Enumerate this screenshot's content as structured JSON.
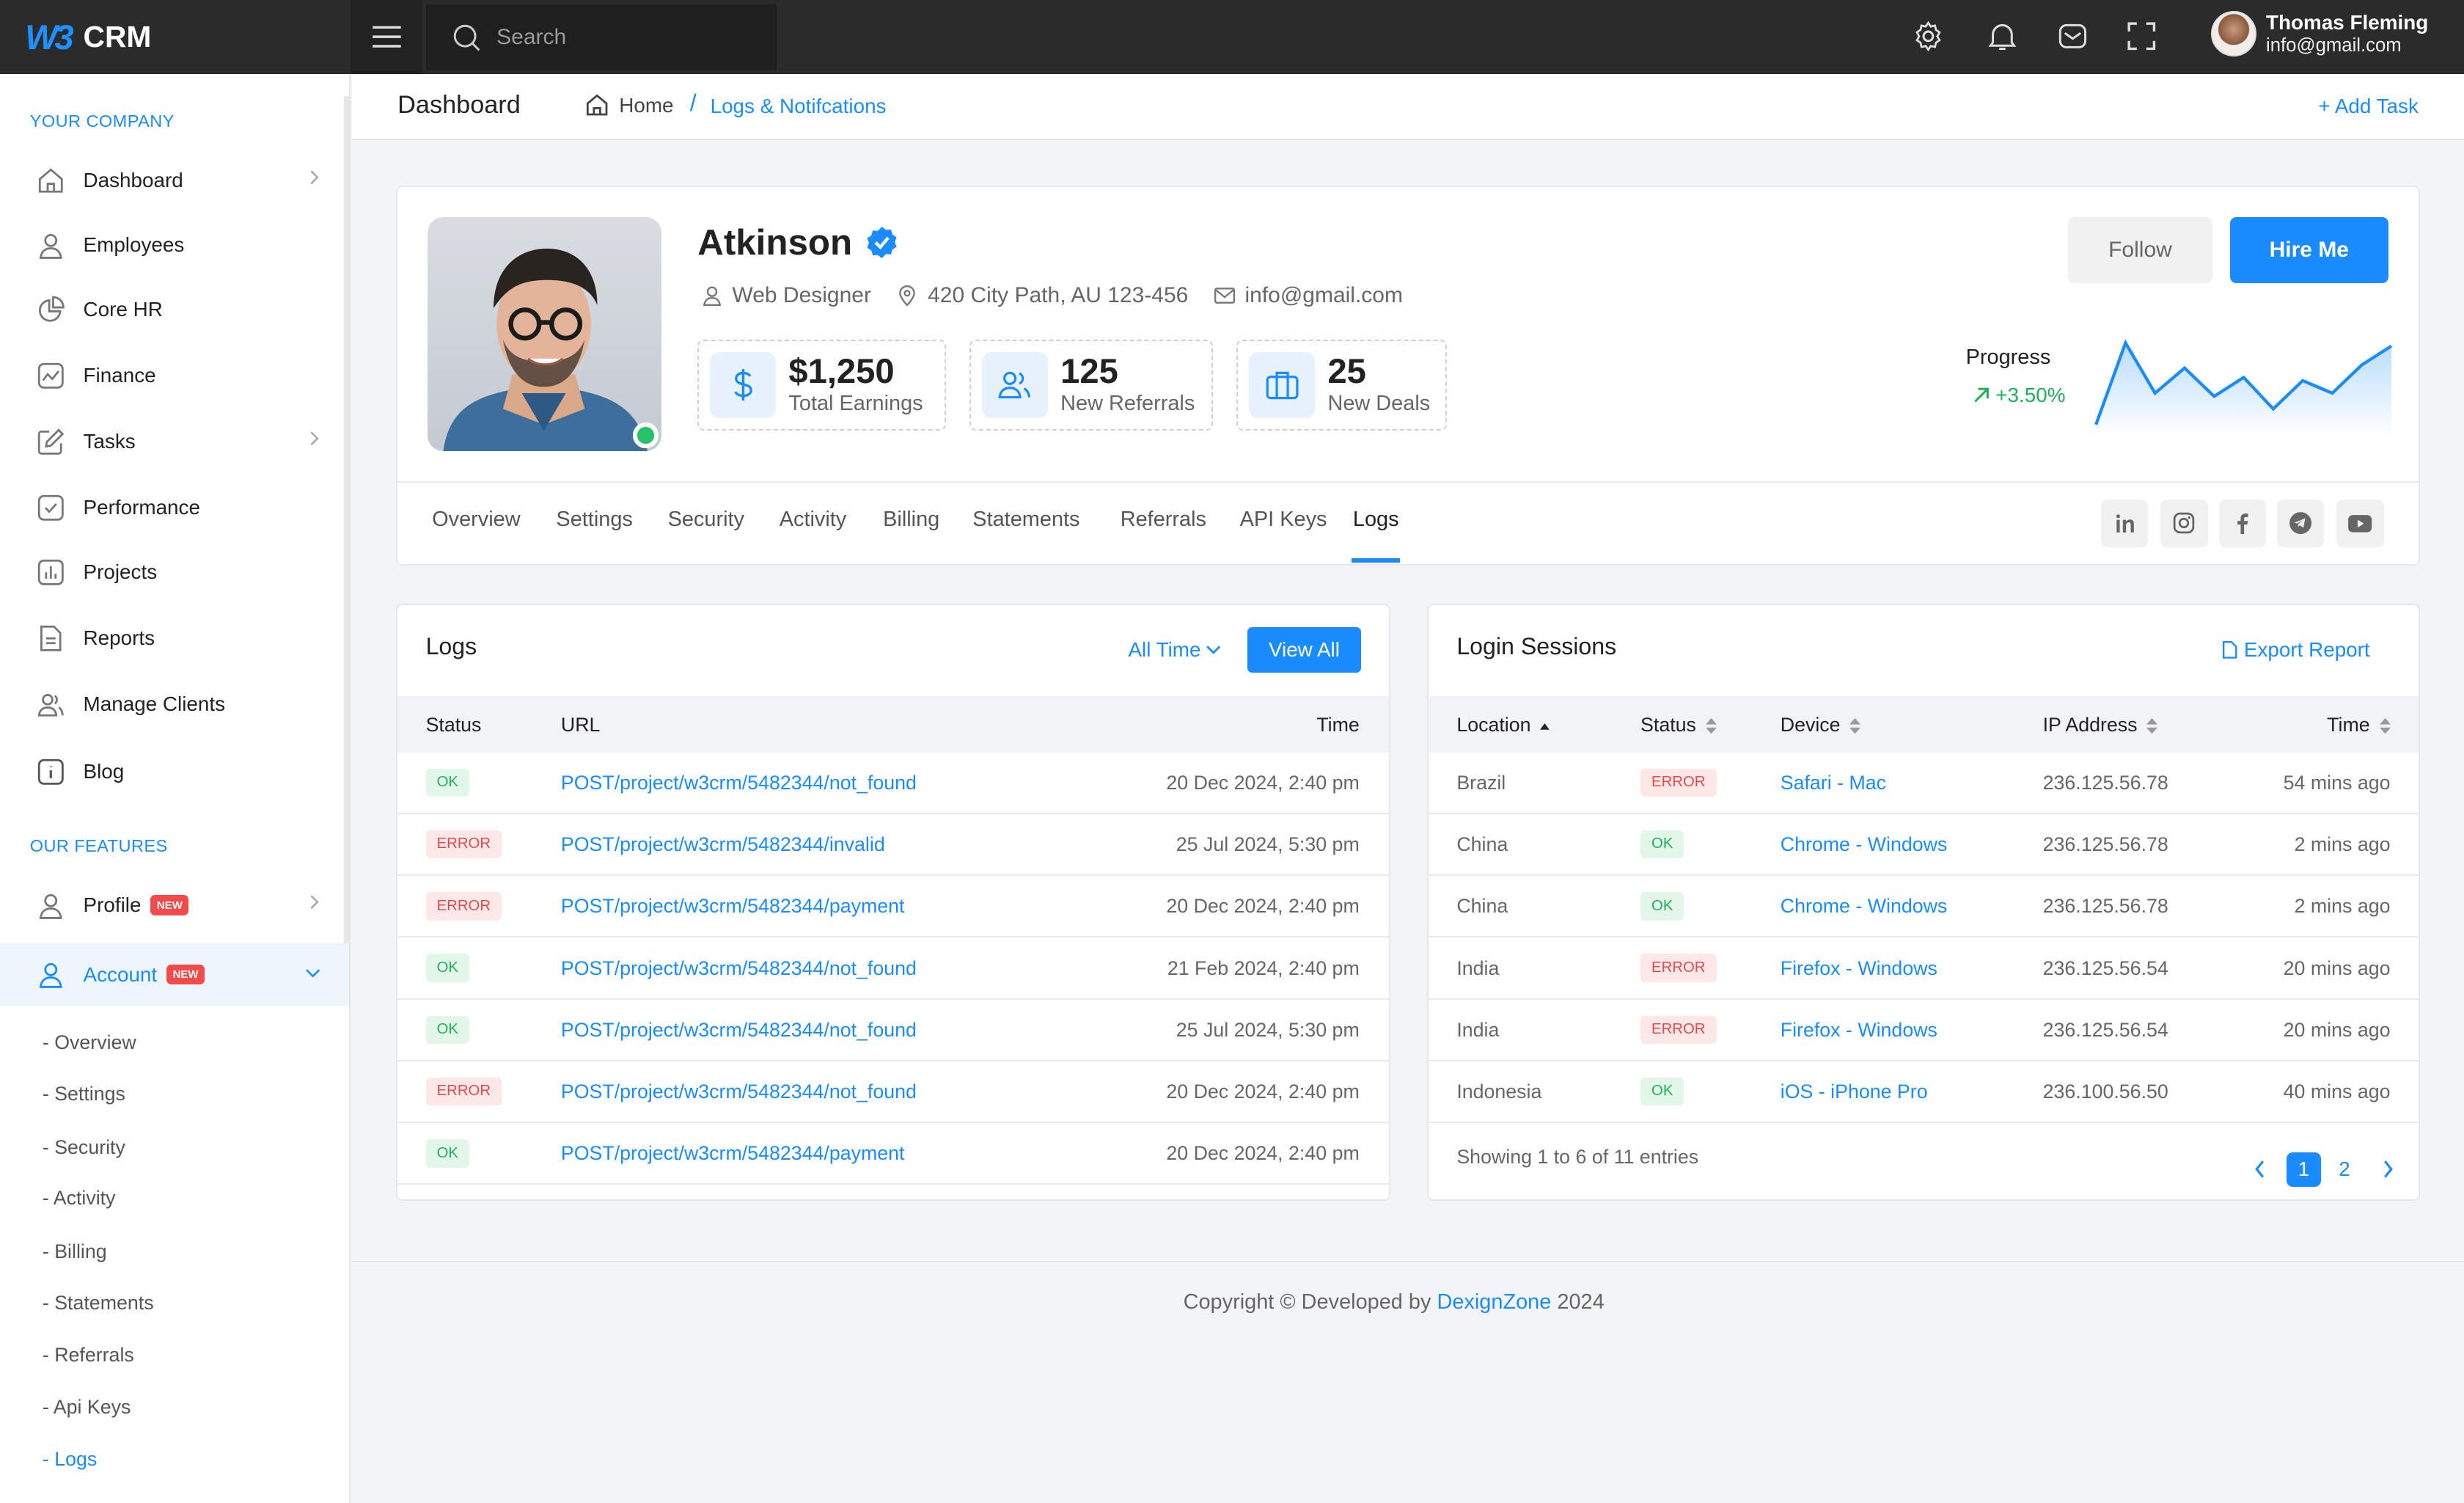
{
  "app": {
    "logo_text": "W3",
    "name": "CRM"
  },
  "header": {
    "search_placeholder": "Search",
    "user_name": "Thomas Fleming",
    "user_email": "info@gmail.com"
  },
  "sidebar": {
    "section1": "YOUR COMPANY",
    "items": [
      {
        "label": "Dashboard"
      },
      {
        "label": "Employees"
      },
      {
        "label": "Core HR"
      },
      {
        "label": "Finance"
      },
      {
        "label": "Tasks"
      },
      {
        "label": "Performance"
      },
      {
        "label": "Projects"
      },
      {
        "label": "Reports"
      },
      {
        "label": "Manage Clients"
      },
      {
        "label": "Blog"
      }
    ],
    "section2": "OUR FEATURES",
    "profile": {
      "label": "Profile",
      "badge": "NEW"
    },
    "account": {
      "label": "Account",
      "badge": "NEW"
    },
    "subitems": [
      "- Overview",
      "- Settings",
      "- Security",
      "- Activity",
      "- Billing",
      "- Statements",
      "- Referrals",
      "- Api Keys",
      "- Logs"
    ]
  },
  "breadcrumb": {
    "page_title": "Dashboard",
    "home": "Home",
    "separator": "/",
    "current": "Logs & Notifcations",
    "add_task": "+ Add Task"
  },
  "profile": {
    "name": "Atkinson",
    "role": "Web Designer",
    "address": "420 City Path, AU 123-456",
    "email": "info@gmail.com",
    "stats": [
      {
        "value": "$1,250",
        "label": "Total Earnings"
      },
      {
        "value": "125",
        "label": "New Referrals"
      },
      {
        "value": "25",
        "label": "New Deals"
      }
    ],
    "follow_label": "Follow",
    "hire_label": "Hire Me",
    "progress_label": "Progress",
    "progress_value": "+3.50%",
    "sparkline": [
      60,
      8,
      40,
      24,
      42,
      30,
      50,
      32,
      40,
      22,
      10
    ]
  },
  "tabs": [
    "Overview",
    "Settings",
    "Security",
    "Activity",
    "Billing",
    "Statements",
    "Referrals",
    "API Keys",
    "Logs"
  ],
  "active_tab": "Logs",
  "social_icons": [
    "linkedin-icon",
    "instagram-icon",
    "facebook-icon",
    "telegram-icon",
    "youtube-icon"
  ],
  "logs": {
    "title": "Logs",
    "filter": "All Time",
    "view_all": "View All",
    "columns": [
      "Status",
      "URL",
      "Time"
    ],
    "rows": [
      {
        "status": "OK",
        "url": "POST/project/w3crm/5482344/not_found",
        "time": "20 Dec 2024, 2:40 pm"
      },
      {
        "status": "ERROR",
        "url": "POST/project/w3crm/5482344/invalid",
        "time": "25 Jul 2024, 5:30 pm"
      },
      {
        "status": "ERROR",
        "url": "POST/project/w3crm/5482344/payment",
        "time": "20 Dec 2024, 2:40 pm"
      },
      {
        "status": "OK",
        "url": "POST/project/w3crm/5482344/not_found",
        "time": "21 Feb 2024, 2:40 pm"
      },
      {
        "status": "OK",
        "url": "POST/project/w3crm/5482344/not_found",
        "time": "25 Jul 2024, 5:30 pm"
      },
      {
        "status": "ERROR",
        "url": "POST/project/w3crm/5482344/not_found",
        "time": "20 Dec 2024, 2:40 pm"
      },
      {
        "status": "OK",
        "url": "POST/project/w3crm/5482344/payment",
        "time": "20 Dec 2024, 2:40 pm"
      }
    ]
  },
  "sessions": {
    "title": "Login Sessions",
    "export": "Export Report",
    "columns": [
      "Location",
      "Status",
      "Device",
      "IP Address",
      "Time"
    ],
    "rows": [
      {
        "location": "Brazil",
        "status": "ERROR",
        "device": "Safari - Mac",
        "ip": "236.125.56.78",
        "time": "54 mins ago"
      },
      {
        "location": "China",
        "status": "OK",
        "device": "Chrome - Windows",
        "ip": "236.125.56.78",
        "time": "2 mins ago"
      },
      {
        "location": "China",
        "status": "OK",
        "device": "Chrome - Windows",
        "ip": "236.125.56.78",
        "time": "2 mins ago"
      },
      {
        "location": "India",
        "status": "ERROR",
        "device": "Firefox - Windows",
        "ip": "236.125.56.54",
        "time": "20 mins ago"
      },
      {
        "location": "India",
        "status": "ERROR",
        "device": "Firefox - Windows",
        "ip": "236.125.56.54",
        "time": "20 mins ago"
      },
      {
        "location": "Indonesia",
        "status": "OK",
        "device": "iOS - iPhone Pro",
        "ip": "236.100.56.50",
        "time": "40 mins ago"
      }
    ],
    "showing": "Showing 1 to 6 of 11 entries",
    "pages": [
      "1",
      "2"
    ]
  },
  "footer": {
    "prefix": "Copyright © Developed by",
    "brand": "DexignZone",
    "year": "2024"
  },
  "colors": {
    "accent": "#1a8cff",
    "ok": "#22b05b",
    "error": "#e5484d",
    "topbar": "#2b2b2b"
  }
}
